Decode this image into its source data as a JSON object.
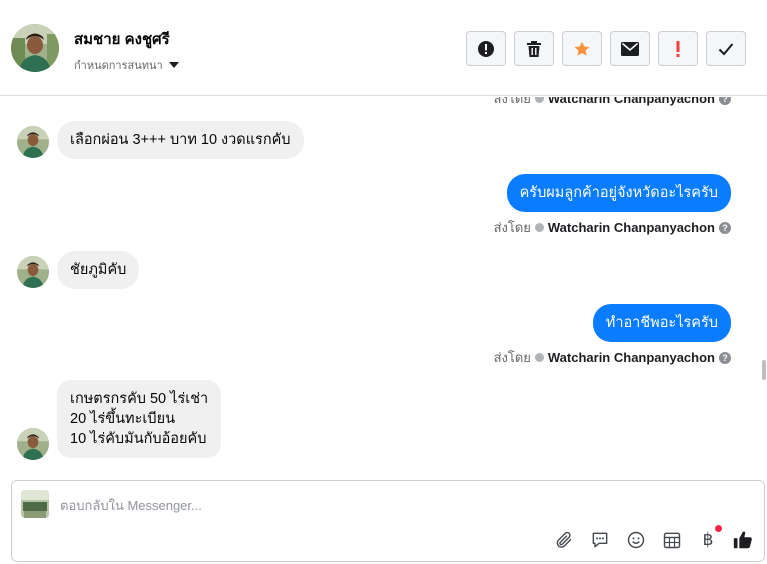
{
  "header": {
    "name": "สมชาย คงชูศรี",
    "assign_label": "กำหนดการสนทนา"
  },
  "toolbar": {
    "icons": [
      "alert-circle-icon",
      "trash-icon",
      "star-icon",
      "envelope-icon",
      "exclamation-icon",
      "check-icon"
    ],
    "star_color": "#f7923b",
    "exclamation_color": "#fa3e3e"
  },
  "messages": {
    "top_sent_by": {
      "prefix": "ส่งโดย",
      "sender": "Watcharin Chanpanyachon"
    },
    "items": [
      {
        "direction": "in",
        "lines": [
          "เลือกผ่อน 3+++ บาท 10 งวดแรกคับ"
        ]
      },
      {
        "direction": "out",
        "text": "ครับผมลูกค้าอยู่จังหวัดอะไรครับ",
        "sent_by_prefix": "ส่งโดย",
        "sender": "Watcharin Chanpanyachon"
      },
      {
        "direction": "in",
        "lines": [
          "ชัยภูมิคับ"
        ]
      },
      {
        "direction": "out",
        "text": "ทำอาชีพอะไรครับ",
        "sent_by_prefix": "ส่งโดย",
        "sender": "Watcharin Chanpanyachon"
      },
      {
        "direction": "in",
        "lines": [
          "เกษตรกรคับ 50 ไร่เช่า",
          "20 ไร่ขึ้นทะเบียน",
          "10 ไร่คับมันกับอ้อยคับ"
        ]
      }
    ]
  },
  "composer": {
    "placeholder": "ตอบกลับใน Messenger...",
    "icons": [
      "paperclip-icon",
      "saved-replies-icon",
      "emoji-icon",
      "appointment-icon",
      "payment-icon",
      "thumbs-up-icon"
    ],
    "baht_symbol": "฿"
  },
  "colors": {
    "outgoing_bubble": "#0a7cff",
    "incoming_bubble": "#f0f0f0",
    "notification_dot": "#f02849"
  }
}
